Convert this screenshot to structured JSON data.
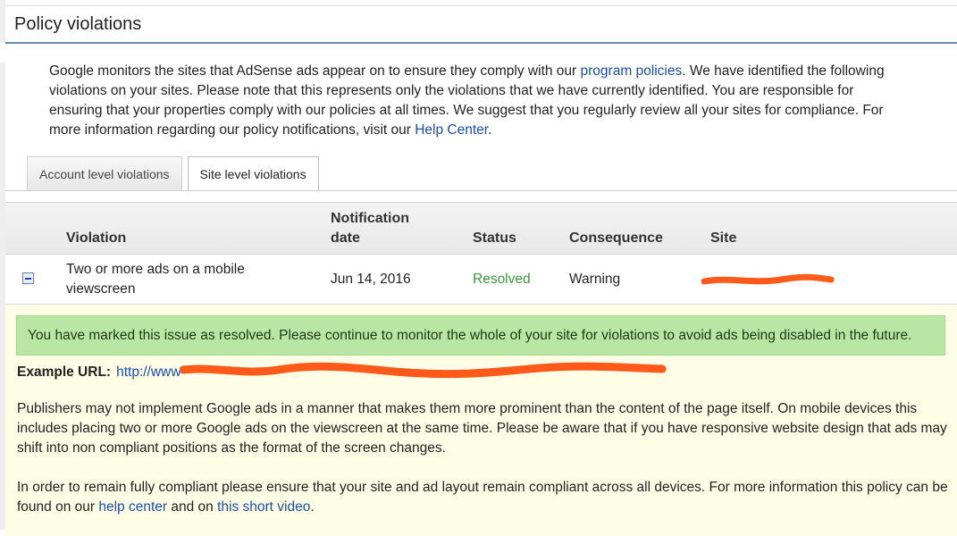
{
  "page": {
    "title": "Policy violations"
  },
  "intro": {
    "text_1": "Google monitors the sites that AdSense ads appear on to ensure they comply with our ",
    "link_program_policies": "program policies",
    "text_2": ". We have identified the following violations on your sites. Please note that this represents only the violations that we have currently identified. You are responsible for ensuring that your properties comply with our policies at all times. We suggest that you regularly review all your sites for compliance. For more information regarding our policy notifications, visit our ",
    "link_help_center": "Help Center",
    "text_3": "."
  },
  "tabs": [
    {
      "label": "Account level violations",
      "active": false
    },
    {
      "label": "Site level violations",
      "active": true
    }
  ],
  "table": {
    "columns": {
      "violation": "Violation",
      "notification_date_1": "Notification",
      "notification_date_2": "date",
      "status": "Status",
      "consequence": "Consequence",
      "site": "Site"
    },
    "rows": [
      {
        "violation": "Two or more ads on a mobile viewscreen",
        "date": "Jun 14, 2016",
        "status": "Resolved",
        "consequence": "Warning"
      }
    ]
  },
  "details": {
    "notice": "You have marked this issue as resolved. Please continue to monitor the whole of your site for violations to avoid ads being disabled in the future.",
    "example_label": "Example URL:",
    "example_url_prefix": "http://www",
    "para1": "Publishers may not implement Google ads in a manner that makes them more prominent than the content of the page itself. On mobile devices this includes placing two or more Google ads on the viewscreen at the same time. Please be aware that if you have responsive website design that ads may shift into non compliant positions as the format of the screen changes.",
    "para2_text_1": "In order to remain fully compliant please ensure that your site and ad layout remain compliant across all devices. For more information this policy can be found on our ",
    "para2_link_help": "help center",
    "para2_text_2": " and on ",
    "para2_link_video": "this short video",
    "para2_text_3": "."
  },
  "colors": {
    "link": "#1a4eb0",
    "resolved": "#3a9a3a",
    "notice_bg": "#b9e6a4",
    "details_bg": "#fefde6",
    "redaction": "#ff5a1a"
  }
}
